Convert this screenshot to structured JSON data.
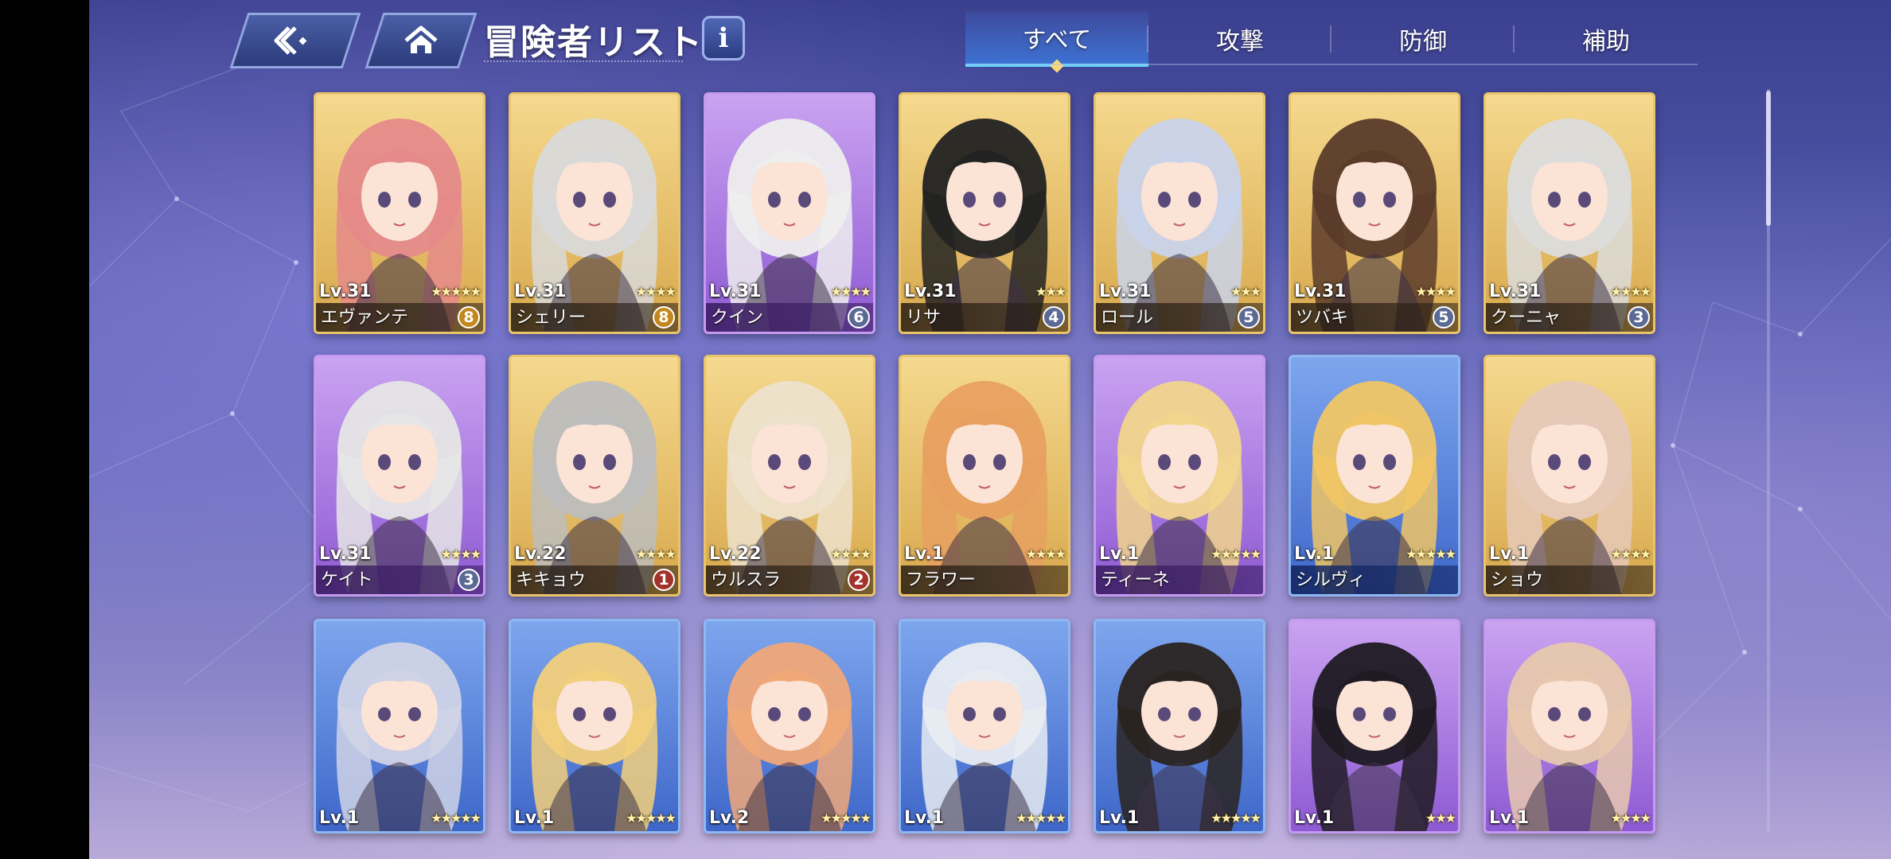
{
  "header": {
    "title": "冒険者リスト",
    "info_glyph": "i"
  },
  "tabs": [
    {
      "label": "すべて",
      "active": true
    },
    {
      "label": "攻撃",
      "active": false
    },
    {
      "label": "防御",
      "active": false
    },
    {
      "label": "補助",
      "active": false
    }
  ],
  "colors": {
    "rarity_gold": "#e9c46a",
    "rarity_purple": "#c59af0",
    "rarity_blue": "#8fb7f2"
  },
  "adventurers": [
    {
      "level": "Lv.31",
      "name": "エヴァンテ",
      "stars": "★★★★★",
      "count": "8",
      "rarity": "gold",
      "badge": "gold",
      "hair": "#e58a8a"
    },
    {
      "level": "Lv.31",
      "name": "シェリー",
      "stars": "★★★★",
      "count": "8",
      "rarity": "gold",
      "badge": "gold",
      "hair": "#d9d9d9"
    },
    {
      "level": "Lv.31",
      "name": "クイン",
      "stars": "★★★★",
      "count": "6",
      "rarity": "purple",
      "badge": "silver",
      "hair": "#eeeeee"
    },
    {
      "level": "Lv.31",
      "name": "リサ",
      "stars": "★★★",
      "count": "4",
      "rarity": "gold",
      "badge": "silver",
      "hair": "#222222"
    },
    {
      "level": "Lv.31",
      "name": "ロール",
      "stars": "★★★",
      "count": "5",
      "rarity": "gold",
      "badge": "silver",
      "hair": "#c9d3ea"
    },
    {
      "level": "Lv.31",
      "name": "ツバキ",
      "stars": "★★★★",
      "count": "5",
      "rarity": "gold",
      "badge": "silver",
      "hair": "#5a3b2a"
    },
    {
      "level": "Lv.31",
      "name": "クーニャ",
      "stars": "★★★★",
      "count": "3",
      "rarity": "gold",
      "badge": "silver",
      "hair": "#dcdcdc"
    },
    {
      "level": "Lv.31",
      "name": "ケイト",
      "stars": "★★★★",
      "count": "3",
      "rarity": "purple",
      "badge": "silver",
      "hair": "#e6e6e6"
    },
    {
      "level": "Lv.22",
      "name": "キキョウ",
      "stars": "★★★★",
      "count": "1",
      "rarity": "gold",
      "badge": "red",
      "hair": "#bdbdbd"
    },
    {
      "level": "Lv.22",
      "name": "ウルスラ",
      "stars": "★★★★",
      "count": "2",
      "rarity": "gold",
      "badge": "red",
      "hair": "#ede2cc"
    },
    {
      "level": "Lv.1",
      "name": "フラワー",
      "stars": "★★★★",
      "count": "",
      "rarity": "gold",
      "badge": "",
      "hair": "#e8a060"
    },
    {
      "level": "Lv.1",
      "name": "ティーネ",
      "stars": "★★★★★",
      "count": "",
      "rarity": "purple",
      "badge": "",
      "hair": "#f1d58c"
    },
    {
      "level": "Lv.1",
      "name": "シルヴィ",
      "stars": "★★★★★",
      "count": "",
      "rarity": "blue",
      "badge": "",
      "hair": "#f0c665"
    },
    {
      "level": "Lv.1",
      "name": "ショウ",
      "stars": "★★★★",
      "count": "",
      "rarity": "gold",
      "badge": "",
      "hair": "#e6c9b8"
    },
    {
      "level": "Lv.1",
      "name": "",
      "stars": "★★★★★",
      "count": "",
      "rarity": "blue",
      "badge": "",
      "hair": "#cfd3e6"
    },
    {
      "level": "Lv.1",
      "name": "",
      "stars": "★★★★★",
      "count": "",
      "rarity": "blue",
      "badge": "",
      "hair": "#f2cf7a"
    },
    {
      "level": "Lv.2",
      "name": "",
      "stars": "★★★★★",
      "count": "",
      "rarity": "blue",
      "badge": "",
      "hair": "#f0a879"
    },
    {
      "level": "Lv.1",
      "name": "",
      "stars": "★★★★★",
      "count": "",
      "rarity": "blue",
      "badge": "",
      "hair": "#e8ecf2"
    },
    {
      "level": "Lv.1",
      "name": "",
      "stars": "★★★★★",
      "count": "",
      "rarity": "blue",
      "badge": "",
      "hair": "#2a2320"
    },
    {
      "level": "Lv.1",
      "name": "",
      "stars": "★★★",
      "count": "",
      "rarity": "purple",
      "badge": "",
      "hair": "#1e1a22"
    },
    {
      "level": "Lv.1",
      "name": "",
      "stars": "★★★★",
      "count": "",
      "rarity": "purple",
      "badge": "",
      "hair": "#e7c8ae"
    }
  ]
}
